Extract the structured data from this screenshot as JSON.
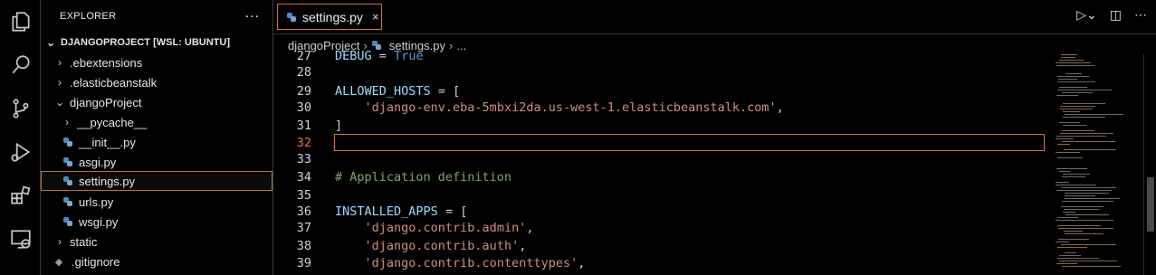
{
  "activity_bar": {
    "icons": [
      "explorer-icon",
      "search-icon",
      "source-control-icon",
      "run-debug-icon",
      "extensions-icon",
      "remote-explorer-icon"
    ]
  },
  "sidebar": {
    "title": "EXPLORER",
    "more_label": "...",
    "root_label": "DJANGOPROJECT [WSL: UBUNTU]",
    "items": [
      {
        "label": ".ebextensions",
        "type": "folder",
        "expanded": false
      },
      {
        "label": ".elasticbeanstalk",
        "type": "folder",
        "expanded": false
      },
      {
        "label": "djangoProject",
        "type": "folder",
        "expanded": true
      },
      {
        "label": "__pycache__",
        "type": "folder",
        "expanded": false
      },
      {
        "label": "__init__.py",
        "type": "python"
      },
      {
        "label": "asgi.py",
        "type": "python"
      },
      {
        "label": "settings.py",
        "type": "python",
        "selected": true
      },
      {
        "label": "urls.py",
        "type": "python"
      },
      {
        "label": "wsgi.py",
        "type": "python"
      },
      {
        "label": "static",
        "type": "folder",
        "expanded": false
      },
      {
        "label": ".gitignore",
        "type": "git"
      }
    ]
  },
  "tab": {
    "label": "settings.py",
    "close": "×"
  },
  "breadcrumb": {
    "folder": "djangoProject",
    "file": "settings.py",
    "more": "..."
  },
  "code": {
    "current_line": "32",
    "lines": [
      {
        "n": "27",
        "text": "DEBUG = True"
      },
      {
        "n": "28",
        "text": ""
      },
      {
        "n": "29",
        "text": "ALLOWED_HOSTS = ["
      },
      {
        "n": "30",
        "text": "    'django-env.eba-5mbxi2da.us-west-1.elasticbeanstalk.com',"
      },
      {
        "n": "31",
        "text": "]"
      },
      {
        "n": "32",
        "text": ""
      },
      {
        "n": "33",
        "text": ""
      },
      {
        "n": "34",
        "text": "# Application definition"
      },
      {
        "n": "35",
        "text": ""
      },
      {
        "n": "36",
        "text": "INSTALLED_APPS = ["
      },
      {
        "n": "37",
        "text": "    'django.contrib.admin',"
      },
      {
        "n": "38",
        "text": "    'django.contrib.auth',"
      },
      {
        "n": "39",
        "text": "    'django.contrib.contenttypes',"
      }
    ]
  },
  "colors": {
    "accent_border": "#e06c4a",
    "string": "#ce9178",
    "variable": "#9cdcfe",
    "constant": "#569cd6",
    "comment": "#7ca668"
  }
}
